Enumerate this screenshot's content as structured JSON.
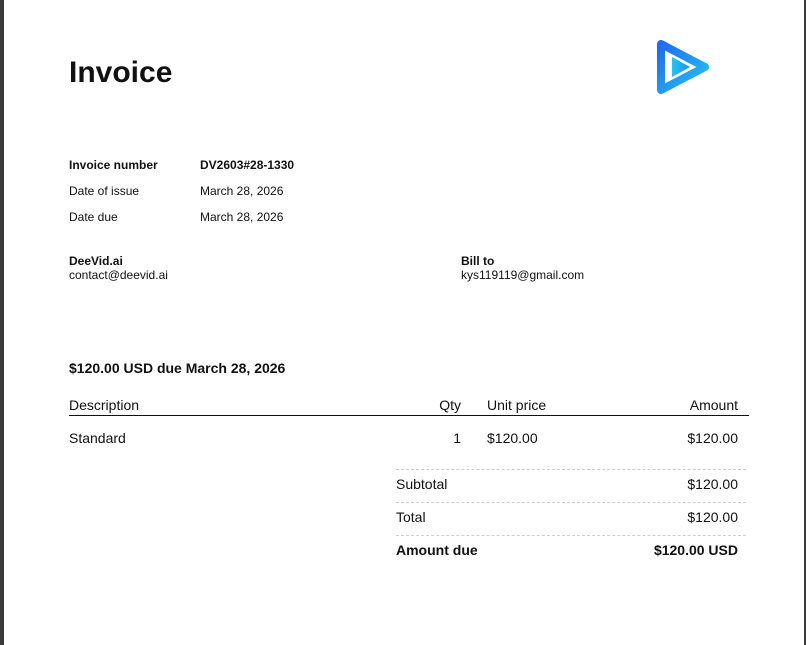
{
  "invoice": {
    "title": "Invoice",
    "logo_icon": "play-logo-icon",
    "meta": [
      {
        "label": "Invoice number",
        "value": "DV2603#28-1330"
      },
      {
        "label": "Date of issue",
        "value": "March 28, 2026"
      },
      {
        "label": "Date due",
        "value": "March 28, 2026"
      }
    ],
    "from": {
      "name": "DeeVid.ai",
      "email": "contact@deevid.ai"
    },
    "bill_to": {
      "label": "Bill to",
      "email": "kys119119@gmail.com"
    },
    "due_summary": "$120.00 USD due March 28, 2026",
    "table": {
      "headers": {
        "description": "Description",
        "qty": "Qty",
        "unit_price": "Unit price",
        "amount": "Amount"
      },
      "items": [
        {
          "description": "Standard",
          "qty": "1",
          "unit_price": "$120.00",
          "amount": "$120.00"
        }
      ]
    },
    "totals": [
      {
        "label": "Subtotal",
        "value": "$120.00"
      },
      {
        "label": "Total",
        "value": "$120.00"
      },
      {
        "label": "Amount due",
        "value": "$120.00 USD"
      }
    ],
    "colors": {
      "logo_start": "#1e6bf0",
      "logo_end": "#22c5f5"
    }
  }
}
